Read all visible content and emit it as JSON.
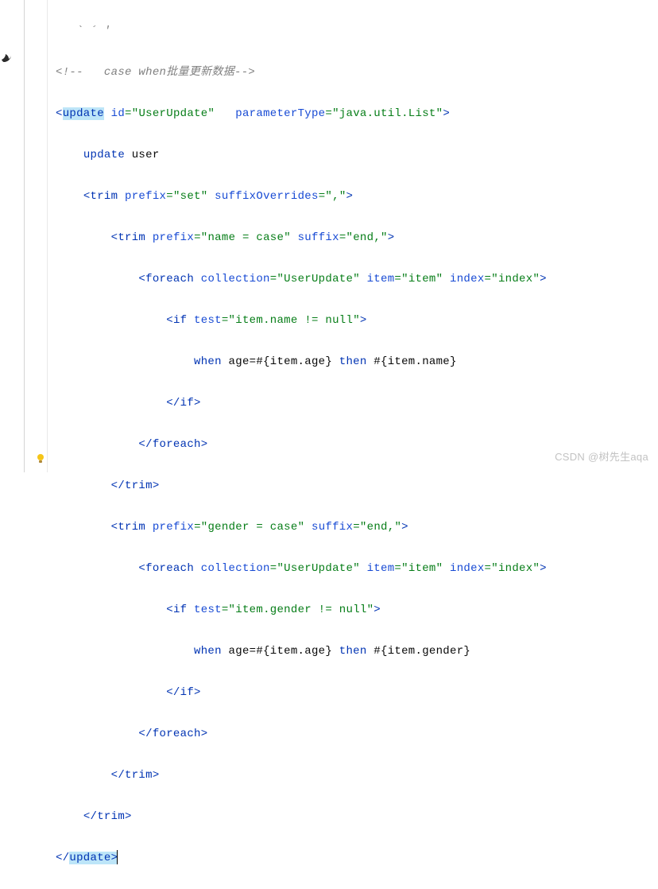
{
  "lines": {
    "l0": "   ` ´ '",
    "l1": "<!--   case when批量更新数据-->",
    "l2_tag_open": "<",
    "l2_tag": "update",
    "l2_sp": " ",
    "l2_attr1": "id",
    "l2_eq": "=",
    "l2_q": "\"",
    "l2_v1": "UserUpdate",
    "l2_attr2": "parameterType",
    "l2_v2": "java.util.List",
    "l3_text": "update user",
    "l4_trim": "trim",
    "l4_prefix_attr": "prefix",
    "l4_prefix_val": "set",
    "l4_suffix_attr": "suffixOverrides",
    "l4_suffix_val": ",",
    "l5_prefix_val": "name = case",
    "l5_suffix_attr": "suffix",
    "l5_suffix_val": "end,",
    "foreach": "foreach",
    "fe_coll_attr": "collection",
    "fe_coll_val": "UserUpdate",
    "fe_item_attr": "item",
    "fe_item_val": "item",
    "fe_index_attr": "index",
    "fe_index_val": "index",
    "if": "if",
    "if_test_attr": "test",
    "if_test_val1": "item.name != null",
    "if_test_val2": "item.gender != null",
    "when_text1": "when age=#{item.age} then #{item.name}",
    "when_text2": "when age=#{item.age} then #{item.gender}",
    "when_kw": "when",
    "then_kw": "then",
    "l12_prefix_val": "gender = case",
    "close_if": "</if>",
    "close_foreach": "</foreach>",
    "close_trim": "</trim>",
    "close_update": "</update>"
  },
  "watermark": "CSDN @树先生aqa"
}
